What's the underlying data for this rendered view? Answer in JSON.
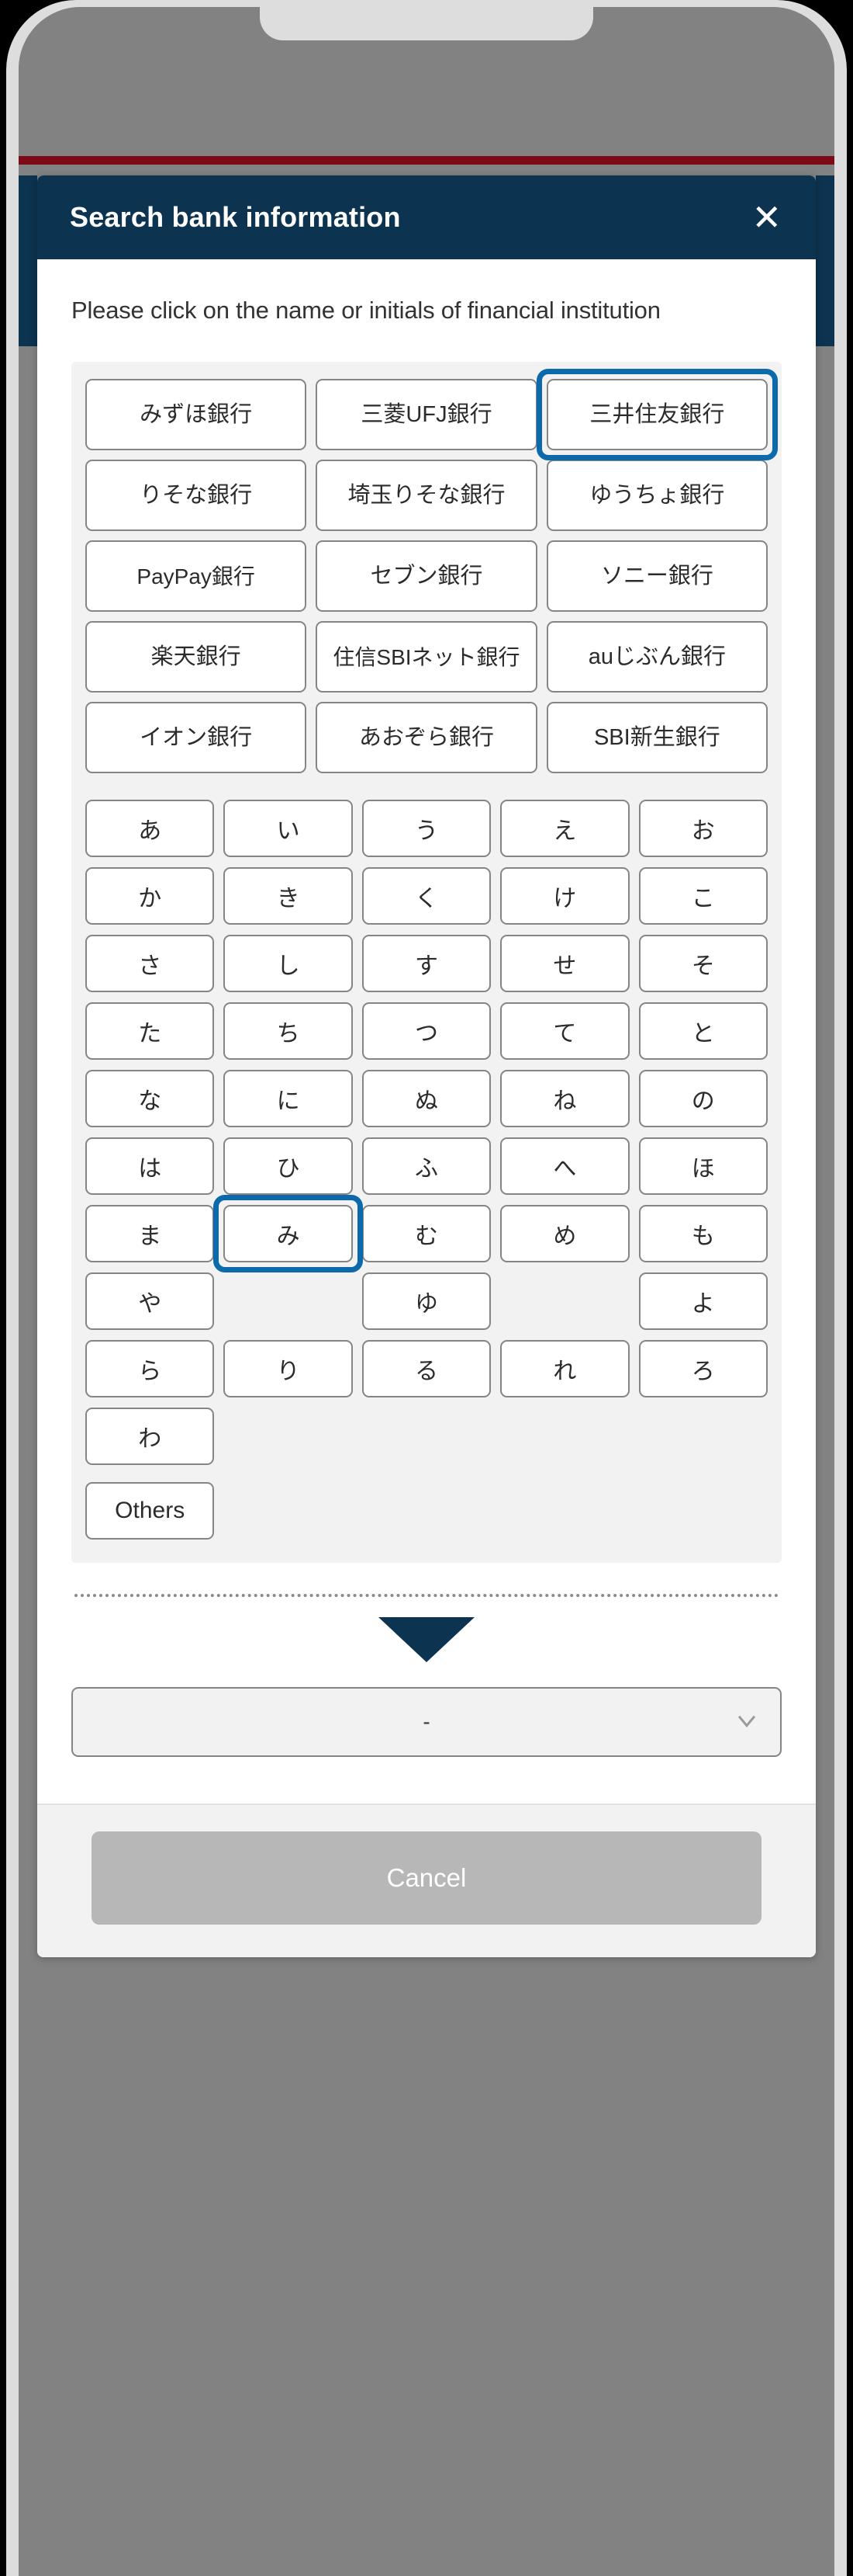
{
  "modal": {
    "title": "Search bank information",
    "close_label": "✕",
    "instruction": "Please click on the name or initials of financial institution"
  },
  "bank_buttons": [
    [
      {
        "label": "みずほ銀行",
        "focused": false
      },
      {
        "label": "三菱UFJ銀行",
        "focused": false
      },
      {
        "label": "三井住友銀行",
        "focused": true
      }
    ],
    [
      {
        "label": "りそな銀行",
        "focused": false
      },
      {
        "label": "埼玉りそな銀行",
        "focused": false
      },
      {
        "label": "ゆうちょ銀行",
        "focused": false
      }
    ],
    [
      {
        "label": "PayPay銀行",
        "focused": false
      },
      {
        "label": "セブン銀行",
        "focused": false
      },
      {
        "label": "ソニー銀行",
        "focused": false
      }
    ],
    [
      {
        "label": "楽天銀行",
        "focused": false
      },
      {
        "label": "住信SBIネット銀行",
        "focused": false
      },
      {
        "label": "auじぶん銀行",
        "focused": false
      }
    ],
    [
      {
        "label": "イオン銀行",
        "focused": false
      },
      {
        "label": "あおぞら銀行",
        "focused": false
      },
      {
        "label": "SBI新生銀行",
        "focused": false
      }
    ]
  ],
  "kana_rows": [
    [
      {
        "label": "あ",
        "focused": false
      },
      {
        "label": "い",
        "focused": false
      },
      {
        "label": "う",
        "focused": false
      },
      {
        "label": "え",
        "focused": false
      },
      {
        "label": "お",
        "focused": false
      }
    ],
    [
      {
        "label": "か",
        "focused": false
      },
      {
        "label": "き",
        "focused": false
      },
      {
        "label": "く",
        "focused": false
      },
      {
        "label": "け",
        "focused": false
      },
      {
        "label": "こ",
        "focused": false
      }
    ],
    [
      {
        "label": "さ",
        "focused": false
      },
      {
        "label": "し",
        "focused": false
      },
      {
        "label": "す",
        "focused": false
      },
      {
        "label": "せ",
        "focused": false
      },
      {
        "label": "そ",
        "focused": false
      }
    ],
    [
      {
        "label": "た",
        "focused": false
      },
      {
        "label": "ち",
        "focused": false
      },
      {
        "label": "つ",
        "focused": false
      },
      {
        "label": "て",
        "focused": false
      },
      {
        "label": "と",
        "focused": false
      }
    ],
    [
      {
        "label": "な",
        "focused": false
      },
      {
        "label": "に",
        "focused": false
      },
      {
        "label": "ぬ",
        "focused": false
      },
      {
        "label": "ね",
        "focused": false
      },
      {
        "label": "の",
        "focused": false
      }
    ],
    [
      {
        "label": "は",
        "focused": false
      },
      {
        "label": "ひ",
        "focused": false
      },
      {
        "label": "ふ",
        "focused": false
      },
      {
        "label": "へ",
        "focused": false
      },
      {
        "label": "ほ",
        "focused": false
      }
    ],
    [
      {
        "label": "ま",
        "focused": false
      },
      {
        "label": "み",
        "focused": true
      },
      {
        "label": "む",
        "focused": false
      },
      {
        "label": "め",
        "focused": false
      },
      {
        "label": "も",
        "focused": false
      }
    ],
    [
      {
        "label": "や",
        "focused": false
      },
      {
        "label": "",
        "focused": false,
        "empty": true
      },
      {
        "label": "ゆ",
        "focused": false
      },
      {
        "label": "",
        "focused": false,
        "empty": true
      },
      {
        "label": "よ",
        "focused": false
      }
    ],
    [
      {
        "label": "ら",
        "focused": false
      },
      {
        "label": "り",
        "focused": false
      },
      {
        "label": "る",
        "focused": false
      },
      {
        "label": "れ",
        "focused": false
      },
      {
        "label": "ろ",
        "focused": false
      }
    ],
    [
      {
        "label": "わ",
        "focused": false
      },
      {
        "label": "",
        "focused": false,
        "empty": true
      },
      {
        "label": "",
        "focused": false,
        "empty": true
      },
      {
        "label": "",
        "focused": false,
        "empty": true
      },
      {
        "label": "",
        "focused": false,
        "empty": true
      }
    ]
  ],
  "others_button": {
    "label": "Others"
  },
  "bank_select": {
    "value": "-",
    "chevron": "chevron-down-icon"
  },
  "footer": {
    "cancel_label": "Cancel"
  },
  "background_page": {
    "icons": [
      "home-icon",
      "person-icon",
      "card-icon",
      "list-icon",
      "chart-icon",
      "gear-icon"
    ],
    "accent_line_color": "#7d0b17"
  },
  "colors": {
    "header_navy": "#0c3350",
    "focus_blue": "#0b69ac",
    "panel_gray": "#f2f2f2",
    "cancel_gray": "#b7b7b7",
    "border_gray": "#858585"
  }
}
